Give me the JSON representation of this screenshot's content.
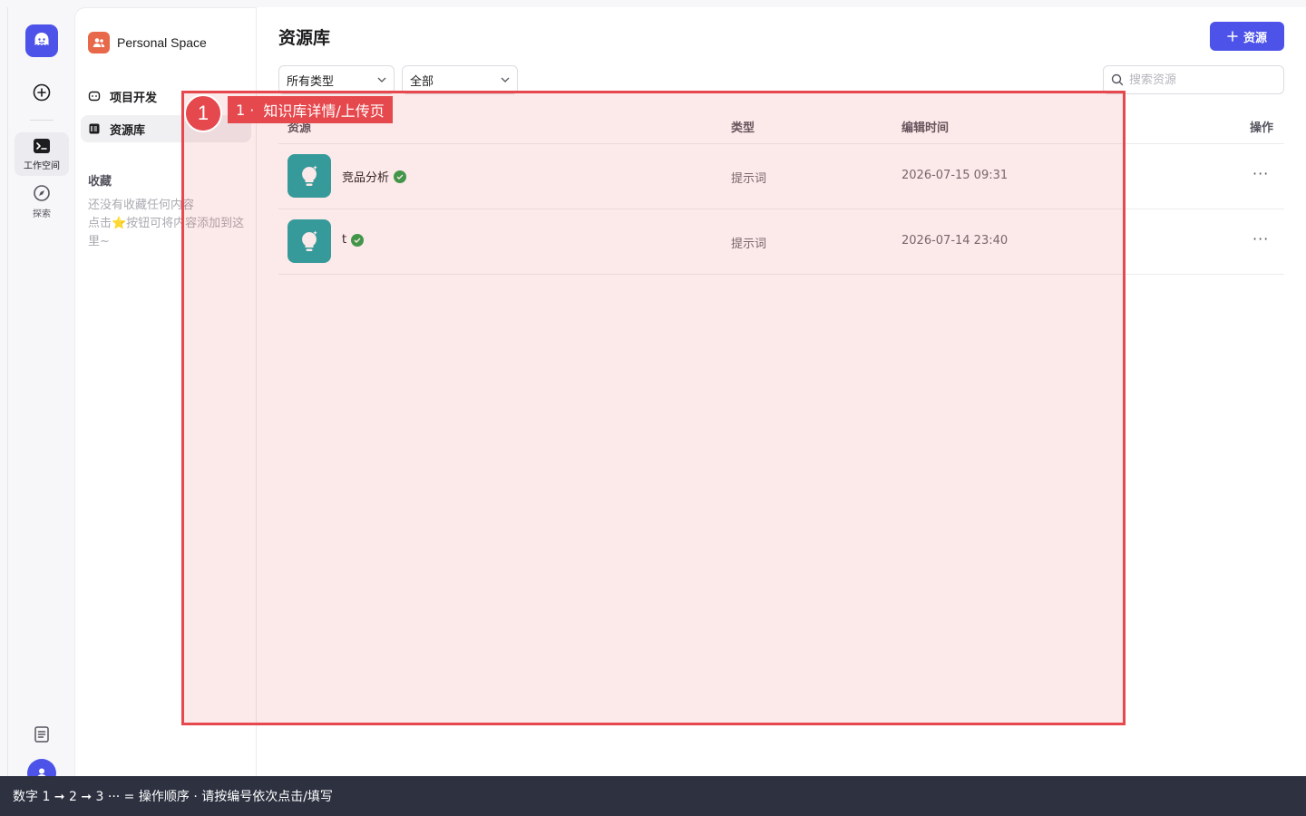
{
  "rail": {
    "workspace_label": "工作空间",
    "explore_label": "探索"
  },
  "sidebar": {
    "space_name": "Personal Space",
    "nav": [
      {
        "label": "项目开发"
      },
      {
        "label": "资源库"
      }
    ],
    "favorites_title": "收藏",
    "favorites_empty_1": "还没有收藏任何内容",
    "favorites_empty_2": "点击⭐按钮可将内容添加到这里~"
  },
  "main": {
    "title": "资源库",
    "add_button_label": "资源",
    "filter_type": "所有类型",
    "filter_scope": "全部",
    "search_placeholder": "搜索资源",
    "columns": {
      "resource": "资源",
      "type": "类型",
      "edit_time": "编辑时间",
      "actions": "操作"
    },
    "rows": [
      {
        "name": "竞品分析",
        "type": "提示词",
        "time": "2026-07-15 09:31",
        "more": "···"
      },
      {
        "name": "t",
        "type": "提示词",
        "time": "2026-07-14 23:40",
        "more": "···"
      }
    ]
  },
  "annotation": {
    "number": "1",
    "prefix": "1 ·",
    "label": "知识库详情/上传页"
  },
  "footer": {
    "text": "数字 1 ➞ 2 ➞ 3 ··· = 操作顺序 · 请按编号依次点击/填写"
  },
  "colors": {
    "brand": "#4d53e8",
    "annotation": "#e5484d",
    "resource_icon": "#1fa6a6",
    "success": "#2ca14a"
  },
  "icons": {
    "logo": "ghost-logo-icon",
    "add": "plus-circle-icon",
    "workspace": "terminal-folder-icon",
    "explore": "compass-icon",
    "doc": "document-icon",
    "avatar": "user-icon",
    "search": "search-icon",
    "resource": "lightbulb-icon"
  }
}
